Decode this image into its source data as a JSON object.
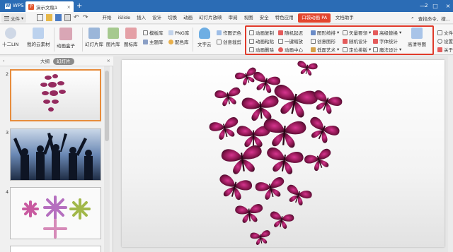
{
  "titlebar": {
    "app_label": "WPS",
    "doc_tab": "演示文稿1",
    "close_glyph": "×",
    "new_tab_glyph": "+",
    "badge": "2",
    "controls": [
      "—",
      "□",
      "×"
    ]
  },
  "menubar": {
    "file_label": "文件",
    "items": [
      "开始",
      "iSlide",
      "插入",
      "设计",
      "切换",
      "动画",
      "幻灯片放映",
      "审阅",
      "视图",
      "安全",
      "特色应用",
      "口袋动画 PA",
      "文档助手"
    ],
    "active_index": 11,
    "search_label": "查找命令、搜..."
  },
  "ribbon": {
    "account": "十二LIN",
    "cloud_assets": "我的云素材",
    "anim_box": "动画盒子",
    "slide_lib": "幻灯片库",
    "pic_lib": "图片库",
    "icon_lib": "图标库",
    "template_lib": "模板库",
    "theme_lib": "主题库",
    "png_lib": "PNG库",
    "color_lib": "配色库",
    "text_cloud": "文字云",
    "pic_extract": "作图识色",
    "creative_crop": "创意裁剪",
    "anim_copy": "动画复制",
    "anim_paste": "动画粘贴",
    "anim_delete": "动画删除",
    "random_start": "随机起迟",
    "one_key_zoom": "一键缩放",
    "anim_center": "动画中心",
    "shape_mix": "图形绮排",
    "creative_shape": "创意图形",
    "poly_art": "低面艺术",
    "vector_edit": "矢量要领",
    "random_design": "随机设计",
    "position_layout": "定位排版",
    "advanced_replace": "高级替换",
    "font_stat": "字体统计",
    "magic_design": "魔法设计",
    "hd_export": "高清导图",
    "file_label": "文件",
    "settings_label": "设置",
    "about_label": "关于"
  },
  "leftpanel": {
    "tab_outline": "大纲",
    "tab_slides": "幻灯片",
    "slide_numbers": [
      "2",
      "3",
      "4"
    ]
  },
  "colors": {
    "titlebar": "#2b6cb5",
    "accent_red": "#e3462e",
    "selection_orange": "#e78c3c",
    "butterfly": "#8b1650"
  }
}
